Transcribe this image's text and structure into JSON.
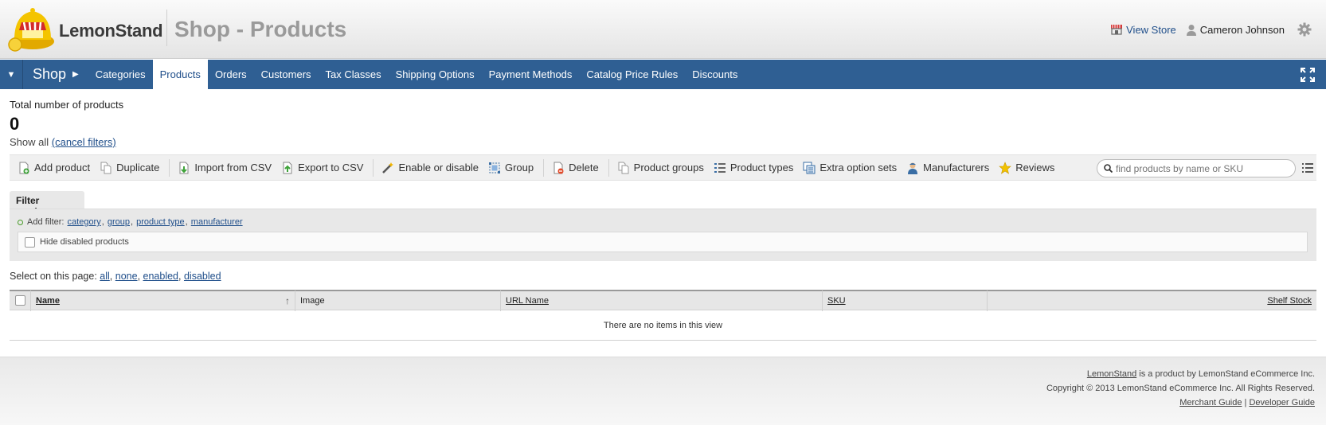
{
  "header": {
    "brand": "LemonStand",
    "title": "Shop - Products",
    "view_store": "View Store",
    "user_name": "Cameron Johnson",
    "icons": {
      "store": "store-icon",
      "user": "user-icon",
      "settings": "gear-icon"
    }
  },
  "nav": {
    "section": "Shop",
    "items": [
      {
        "label": "Categories",
        "active": false
      },
      {
        "label": "Products",
        "active": true
      },
      {
        "label": "Orders",
        "active": false
      },
      {
        "label": "Customers",
        "active": false
      },
      {
        "label": "Tax Classes",
        "active": false
      },
      {
        "label": "Shipping Options",
        "active": false
      },
      {
        "label": "Payment Methods",
        "active": false
      },
      {
        "label": "Catalog Price Rules",
        "active": false
      },
      {
        "label": "Discounts",
        "active": false
      }
    ]
  },
  "summary": {
    "label": "Total number of products",
    "count": "0",
    "show_all": "Show all",
    "cancel_filters": "(cancel filters)"
  },
  "toolbar": {
    "add_product": "Add product",
    "duplicate": "Duplicate",
    "import_csv": "Import from CSV",
    "export_csv": "Export to CSV",
    "enable_disable": "Enable or disable",
    "group": "Group",
    "delete": "Delete",
    "product_groups": "Product groups",
    "product_types": "Product types",
    "extra_option_sets": "Extra option sets",
    "manufacturers": "Manufacturers",
    "reviews": "Reviews",
    "search_placeholder": "find products by name or SKU"
  },
  "filters": {
    "tab": "Filter products",
    "add_filter": "Add filter:",
    "options": [
      "category",
      "group",
      "product type",
      "manufacturer"
    ],
    "hide_disabled": "Hide disabled products"
  },
  "select_page": {
    "label": "Select on this page:",
    "options": [
      "all",
      "none",
      "enabled",
      "disabled"
    ]
  },
  "table": {
    "columns": [
      "Name",
      "Image",
      "URL Name",
      "SKU",
      "Shelf Stock"
    ],
    "empty_message": "There are no items in this view"
  },
  "footer": {
    "brand_link": "LemonStand",
    "line1_rest": " is a product by LemonStand eCommerce Inc.",
    "line2": "Copyright © 2013 LemonStand eCommerce Inc. All Rights Reserved.",
    "merchant_guide": "Merchant Guide",
    "separator": " | ",
    "developer_guide": "Developer Guide"
  },
  "colors": {
    "nav_bg": "#2f5f93",
    "link": "#1f4e8a",
    "accent_yellow": "#f2c200"
  }
}
